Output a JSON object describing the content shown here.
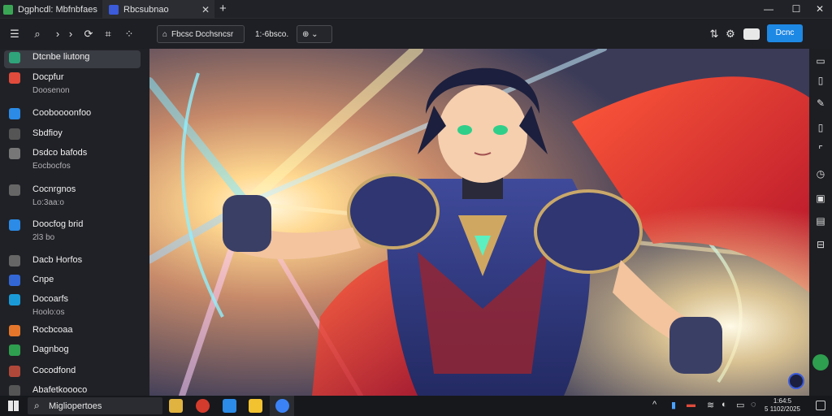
{
  "tabs": [
    {
      "label": "Dgphcdl: Mbfnbfaes",
      "icon": "shield-icon",
      "color": "#3aa655"
    },
    {
      "label": "Rbcsubnao",
      "icon": "app-icon",
      "color": "#3b5bdb",
      "close": "✕"
    }
  ],
  "new_tab": "+",
  "window_controls": {
    "minimize": "—",
    "maximize": "☐",
    "close": "✕"
  },
  "toolbar": {
    "address_label": "Fbcsc Dcchsncsr",
    "zoom_label": "1:-6bsco.",
    "view_label": "⊕ ⌄",
    "primary_button": "Dcnc"
  },
  "sidebar": {
    "items": [
      {
        "label": "Dtcnbe liutong",
        "sub": "",
        "color": "#2fa37a",
        "icon": "folder-icon"
      },
      {
        "label": "Docpfur",
        "sub": "Doosenon",
        "color": "#e04b3b",
        "icon": "heart-icon"
      },
      {
        "label": "Cooboooonfoo",
        "sub": "",
        "color": "#2b8be6",
        "icon": "cube-icon"
      },
      {
        "label": "Sbdfioy",
        "sub": "",
        "color": "#555",
        "icon": "window-icon"
      },
      {
        "label": "Dsdco bafods",
        "sub": "Eocbocfos",
        "color": "#777",
        "icon": "screen-icon"
      },
      {
        "label": "Cocnrgnos",
        "sub": "Lo:3aa:o",
        "color": "#666",
        "icon": "phone-icon"
      },
      {
        "label": "Doocfog brid",
        "sub": "2l3 bo",
        "color": "#2b8be6",
        "icon": "image-icon"
      },
      {
        "label": "Dacb Horfos",
        "sub": "",
        "color": "#666",
        "icon": "music-icon"
      },
      {
        "label": "Cnpe",
        "sub": "",
        "color": "#3367d6",
        "icon": "globe-icon"
      },
      {
        "label": "Docoarfs",
        "sub": "Hoolo:os",
        "color": "#1a9bd7",
        "icon": "pin-icon"
      },
      {
        "label": "Rocbcoaa",
        "sub": "",
        "color": "#e4762c",
        "icon": "circle-icon"
      },
      {
        "label": "Dagnbog",
        "sub": "",
        "color": "#2e9e4f",
        "icon": "square-icon"
      },
      {
        "label": "Cocodfond",
        "sub": "",
        "color": "#b0483a",
        "icon": "palette-icon"
      },
      {
        "label": "Abafetkoooco",
        "sub": "",
        "color": "#555",
        "icon": "user-icon"
      }
    ]
  },
  "taskbar": {
    "search_placeholder": "Migliopertoes",
    "clock_time": "1:64:5",
    "clock_date": "5 1102/2025"
  },
  "colors": {
    "accent": "#1e88e5",
    "chrome": "#202126"
  }
}
